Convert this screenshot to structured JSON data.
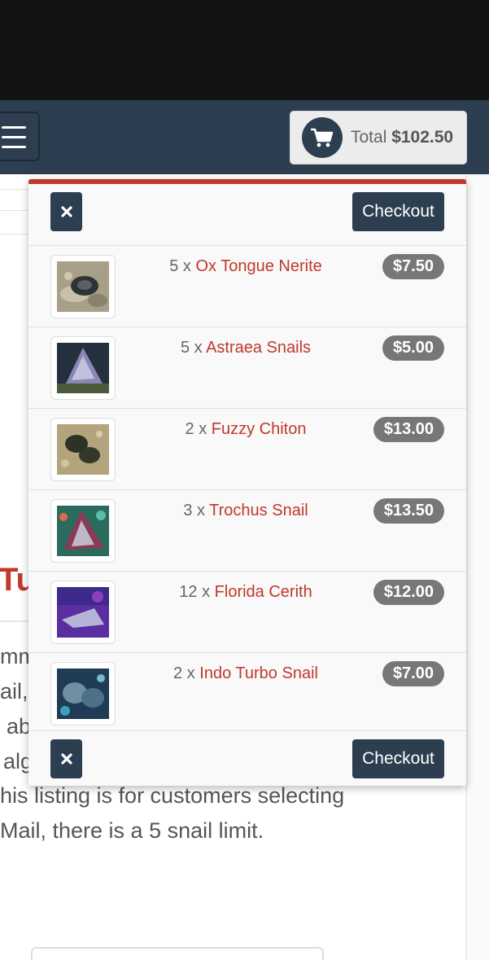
{
  "cart": {
    "total_label": "Total",
    "total_value": "$102.50",
    "icon": "shopping-cart-icon"
  },
  "menu": {
    "icon": "hamburger-menu-icon"
  },
  "dropdown": {
    "checkout_label": "Checkout",
    "close_icon": "close-icon",
    "items": [
      {
        "qty": "5 x",
        "name": "Ox Tongue Nerite",
        "price": "$7.50"
      },
      {
        "qty": "5 x",
        "name": "Astraea Snails",
        "price": "$5.00"
      },
      {
        "qty": "2 x",
        "name": "Fuzzy Chiton",
        "price": "$13.00"
      },
      {
        "qty": "3 x",
        "name": "Trochus Snail",
        "price": "$13.50"
      },
      {
        "qty": "12 x",
        "name": "Florida Cerith",
        "price": "$12.00"
      },
      {
        "qty": "2 x",
        "name": "Indo Turbo Snail",
        "price": "$7.00"
      }
    ]
  },
  "background": {
    "heading": "Tu",
    "lines": [
      "mm",
      "ail,",
      "ab",
      "alg",
      "his listing is for customers selecting",
      "Mail, there is a 5 snail limit."
    ]
  },
  "colors": {
    "navbar": "#2c3e50",
    "accent": "#c0392b",
    "badge": "#777777"
  }
}
